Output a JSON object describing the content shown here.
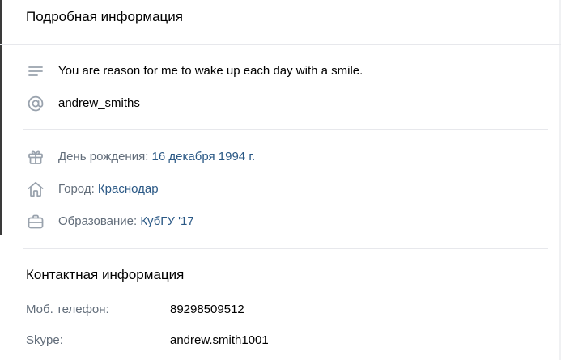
{
  "header": {
    "title": "Подробная информация"
  },
  "about": {
    "status": "You are reason for me to wake up each day with a smile.",
    "nickname": "andrew_smiths"
  },
  "details": {
    "birthday_label": "День рождения: ",
    "birthday_value": "16 декабря 1994 г.",
    "city_label": "Город: ",
    "city_value": "Краснодар",
    "education_label": "Образование: ",
    "education_value": "КубГУ  '17"
  },
  "contacts": {
    "title": "Контактная информация",
    "phone_label": "Моб. телефон:",
    "phone_value": "89298509512",
    "skype_label": "Skype:",
    "skype_value": "andrew.smith1001"
  },
  "icons": {
    "status": "text-lines-icon",
    "nickname": "at-sign-icon",
    "birthday": "gift-icon",
    "city": "home-icon",
    "education": "briefcase-icon"
  },
  "colors": {
    "link": "#2a5885",
    "label": "#626d7a",
    "icon": "#99a2ad",
    "divider": "#e7e8ec"
  }
}
